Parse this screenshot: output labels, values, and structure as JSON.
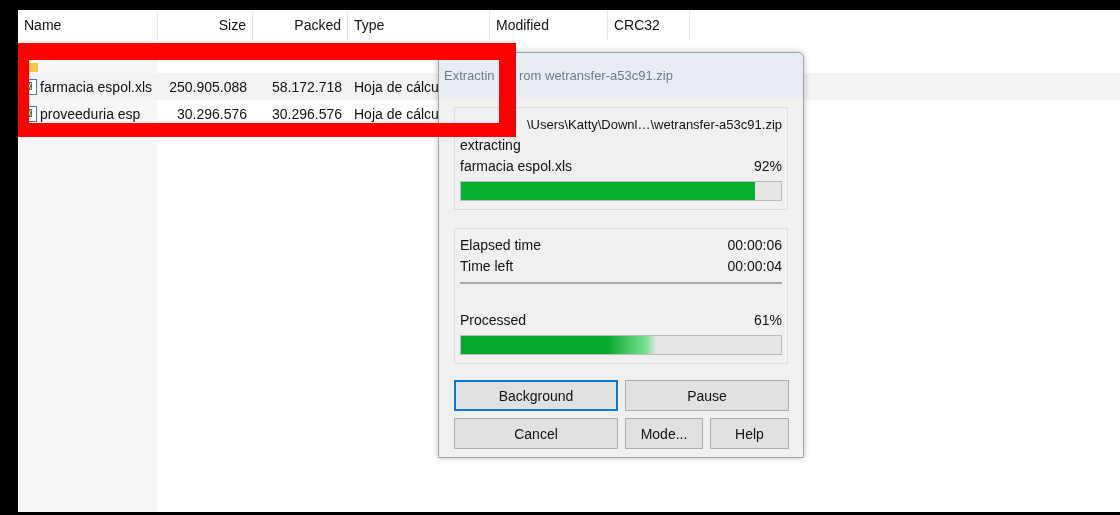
{
  "file_list": {
    "columns": [
      "Name",
      "Size",
      "Packed",
      "Type",
      "Modified",
      "CRC32"
    ],
    "rows": [
      {
        "kind": "folder"
      },
      {
        "kind": "sheet",
        "name": "farmacia espol.xls",
        "size": "250.905.088",
        "packed": "58.172.718",
        "type": "Hoja de cálcu"
      },
      {
        "kind": "sheet",
        "name": "proveeduria esp",
        "size": "30.296.576",
        "packed": "30.296.576",
        "type": "Hoja de cálcu"
      }
    ]
  },
  "dialog": {
    "title_parts": [
      "Extractin",
      "rom wetransfer-a53c91.zip"
    ],
    "archive_path": "\\Users\\Katty\\Downl…\\wetransfer-a53c91.zip",
    "action": "extracting",
    "file_name": "farmacia espol.xls",
    "file_percent": "92%",
    "file_progress": {
      "level": 0.92
    },
    "times": [
      {
        "label": "Elapsed time",
        "value": "00:00:06"
      },
      {
        "label": "Time left",
        "value": "00:00:04"
      }
    ],
    "processed_label": "Processed",
    "processed_percent": "61%",
    "processed_progress": {
      "level": 0.61
    },
    "buttons": [
      {
        "label": "Background",
        "focused": true
      },
      {
        "label": "Pause",
        "focused": false
      },
      {
        "label": "Cancel",
        "focused": false
      },
      {
        "label": "Mode...",
        "focused": false
      },
      {
        "label": "Help",
        "focused": false
      }
    ]
  }
}
